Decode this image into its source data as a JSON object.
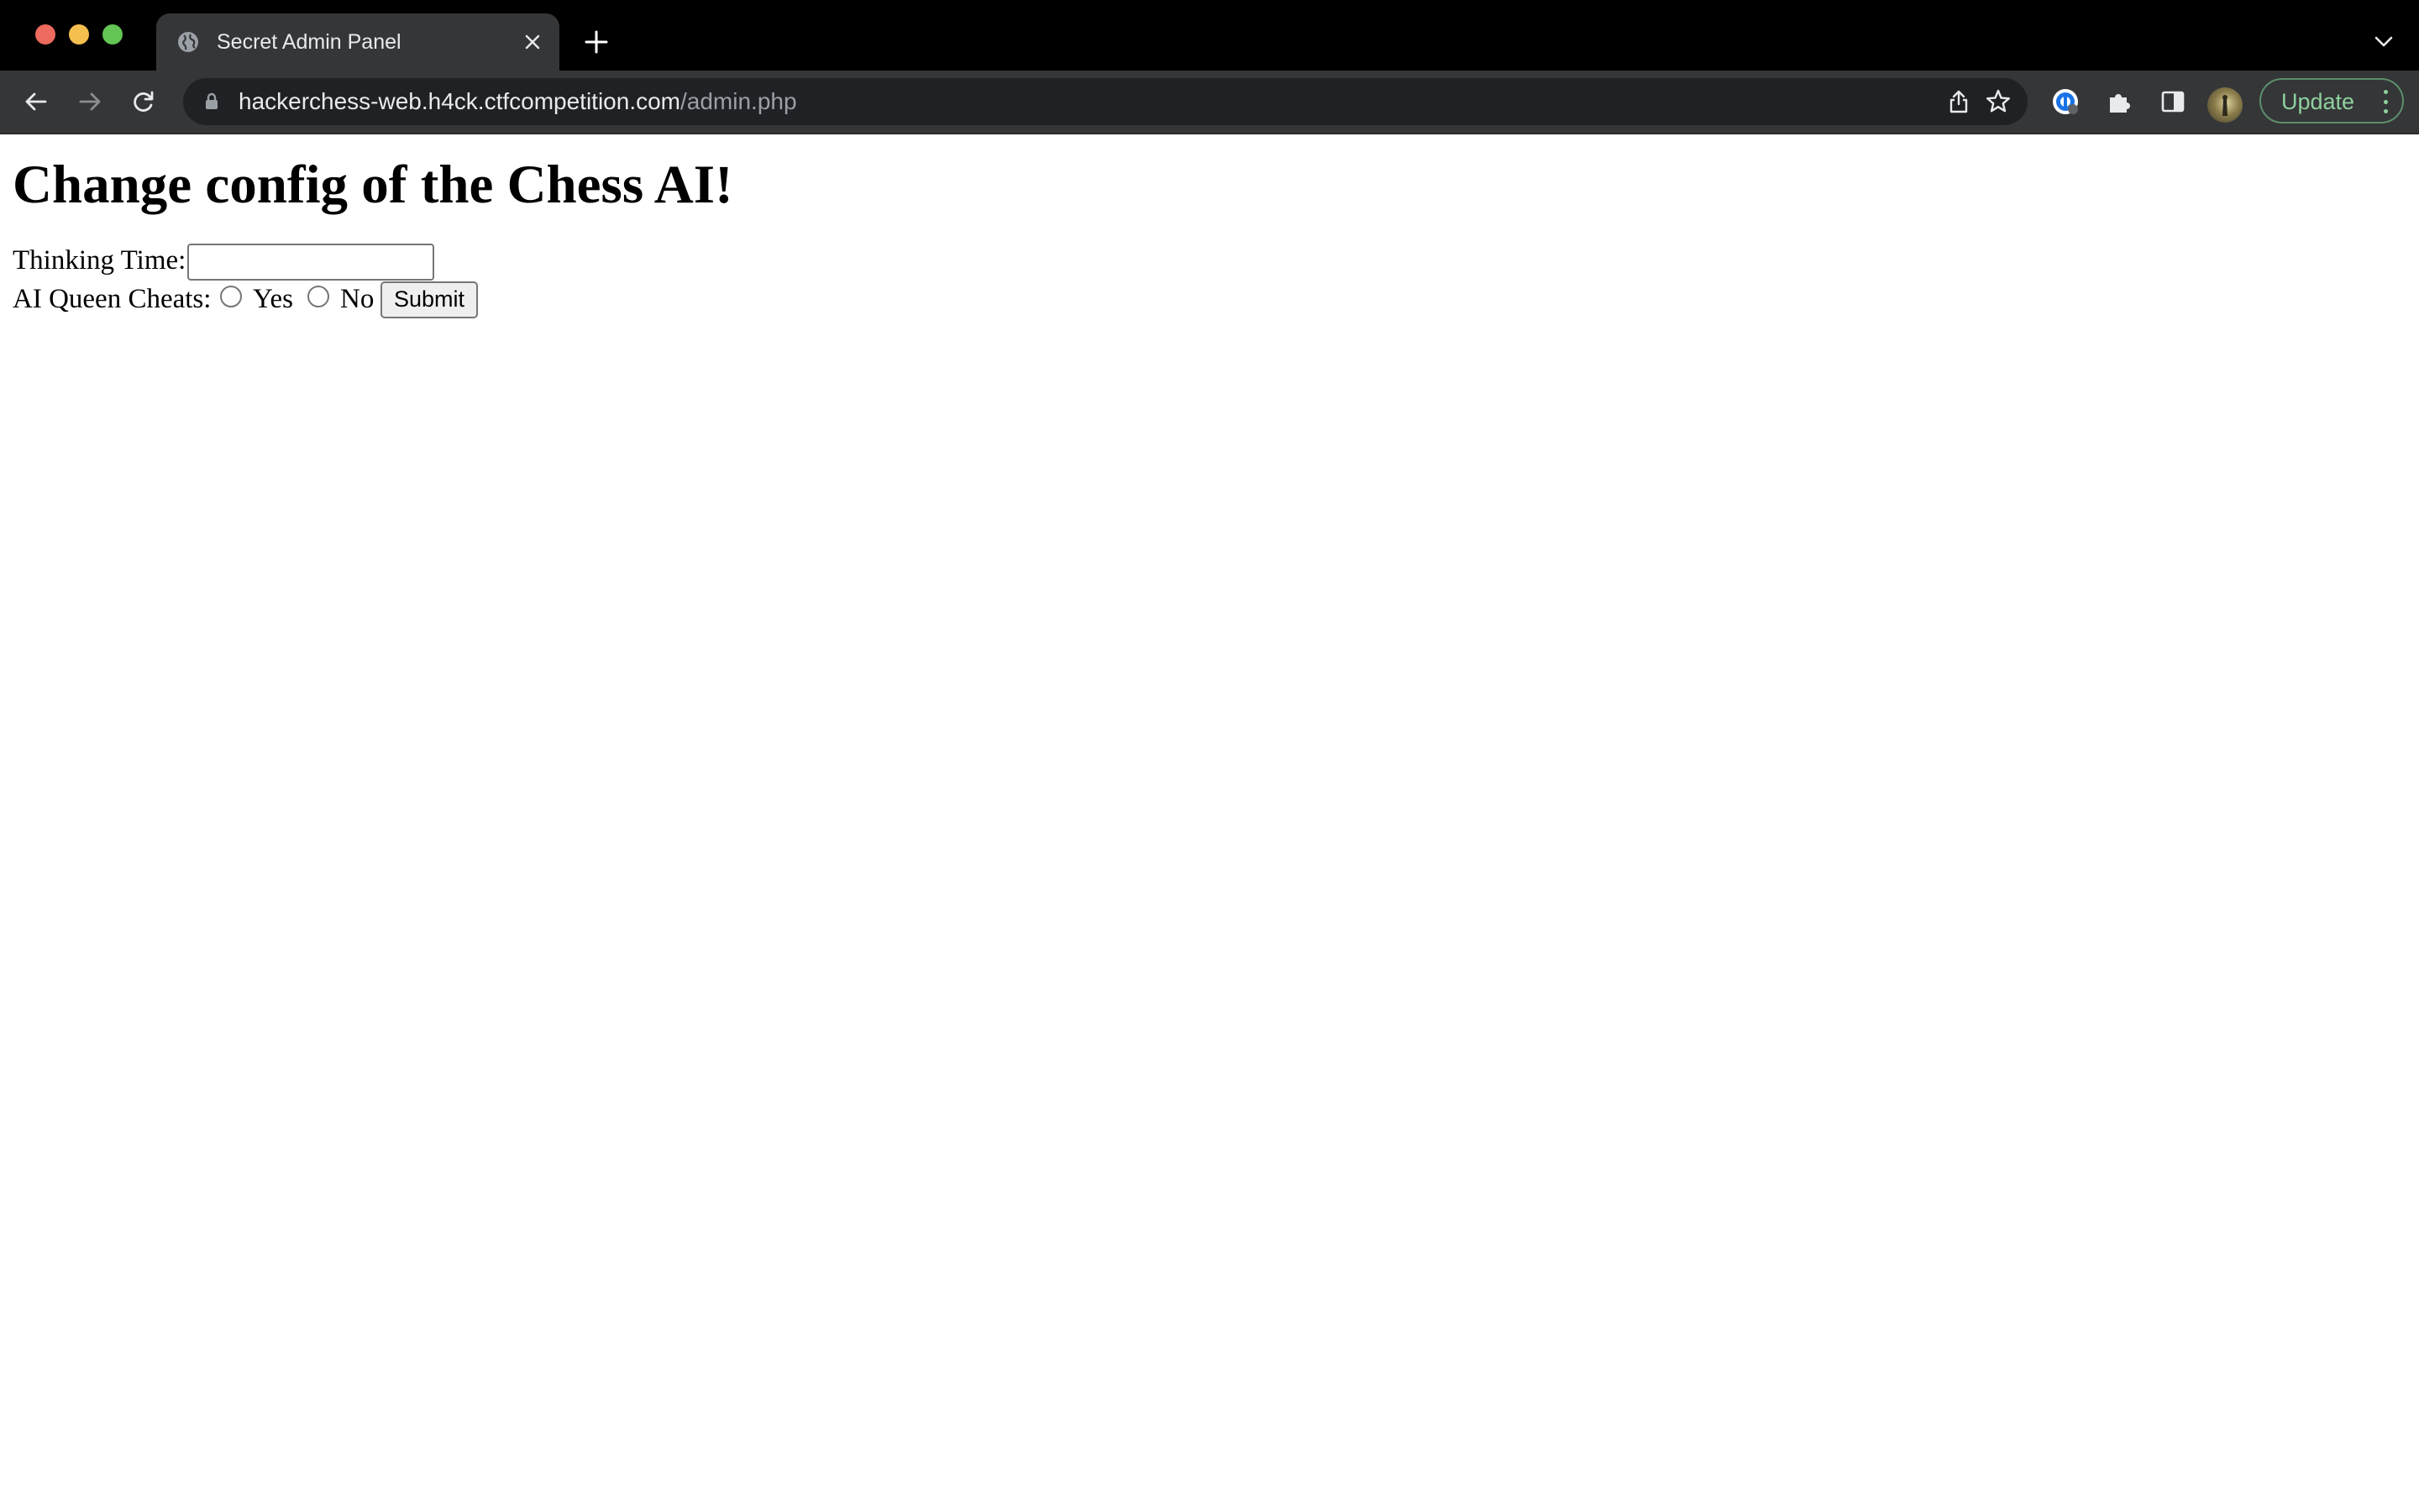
{
  "browser": {
    "tab": {
      "title": "Secret Admin Panel",
      "favicon": "globe-icon"
    },
    "address_bar": {
      "host": "hackerchess-web.h4ck.ctfcompetition.com",
      "path": "/admin.php"
    },
    "update_button_label": "Update",
    "colors": {
      "tabstrip": "#000000",
      "toolbar": "#353638",
      "omnibox": "#202124",
      "update_accent": "#8fd19e"
    }
  },
  "page": {
    "heading": "Change config of the Chess AI!",
    "form": {
      "thinking_time_label": "Thinking Time:",
      "thinking_time_value": "",
      "queen_cheats_label": "AI Queen Cheats:",
      "options": [
        {
          "label": "Yes",
          "checked": false
        },
        {
          "label": "No",
          "checked": false
        }
      ],
      "submit_label": "Submit"
    }
  }
}
